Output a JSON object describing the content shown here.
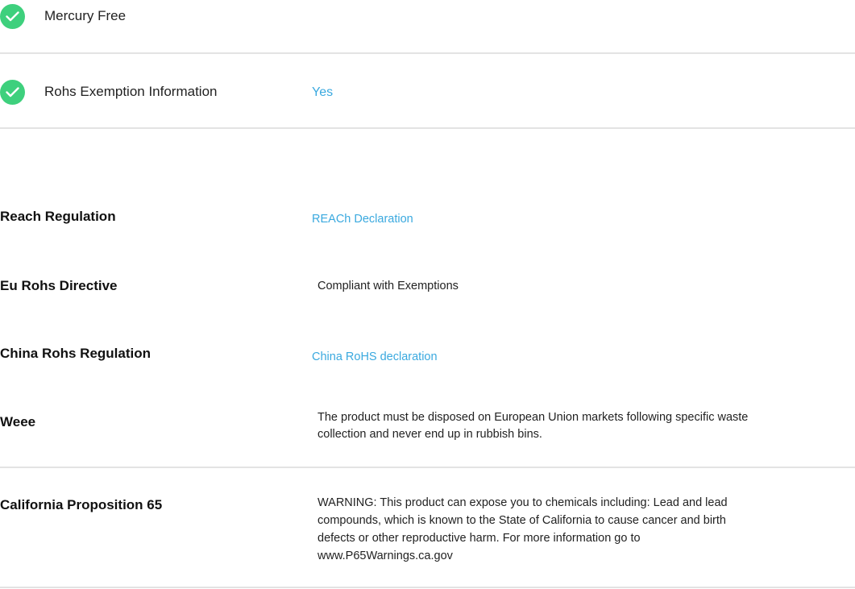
{
  "checks": [
    {
      "label": "Mercury Free",
      "icon": "checkmark-icon"
    },
    {
      "label": "Rohs Exemption Information",
      "value": "Yes",
      "icon": "checkmark-icon"
    }
  ],
  "specs": [
    {
      "label": "Reach Regulation",
      "value": "REACh Declaration",
      "is_link": true
    },
    {
      "label": "Eu Rohs Directive",
      "value": "Compliant with Exemptions",
      "is_link": false
    },
    {
      "label": "China Rohs Regulation",
      "value": "China RoHS declaration",
      "is_link": true
    },
    {
      "label": "Weee",
      "value_lines": [
        "The product must be disposed on European Union markets following specific waste",
        "collection and never end up in rubbish bins."
      ],
      "is_link": false
    },
    {
      "label": "California Proposition 65",
      "value_lines": [
        "WARNING: This product can expose you to chemicals including: Lead and lead",
        "compounds, which is known to the State of California to cause cancer and birth",
        "defects or other reproductive harm. For more information go to",
        "www.P65Warnings.ca.gov"
      ],
      "is_link": false
    }
  ],
  "colors": {
    "check_green": "#3ed07d",
    "link_blue": "#3aa9df",
    "divider": "#e3e3e3"
  }
}
